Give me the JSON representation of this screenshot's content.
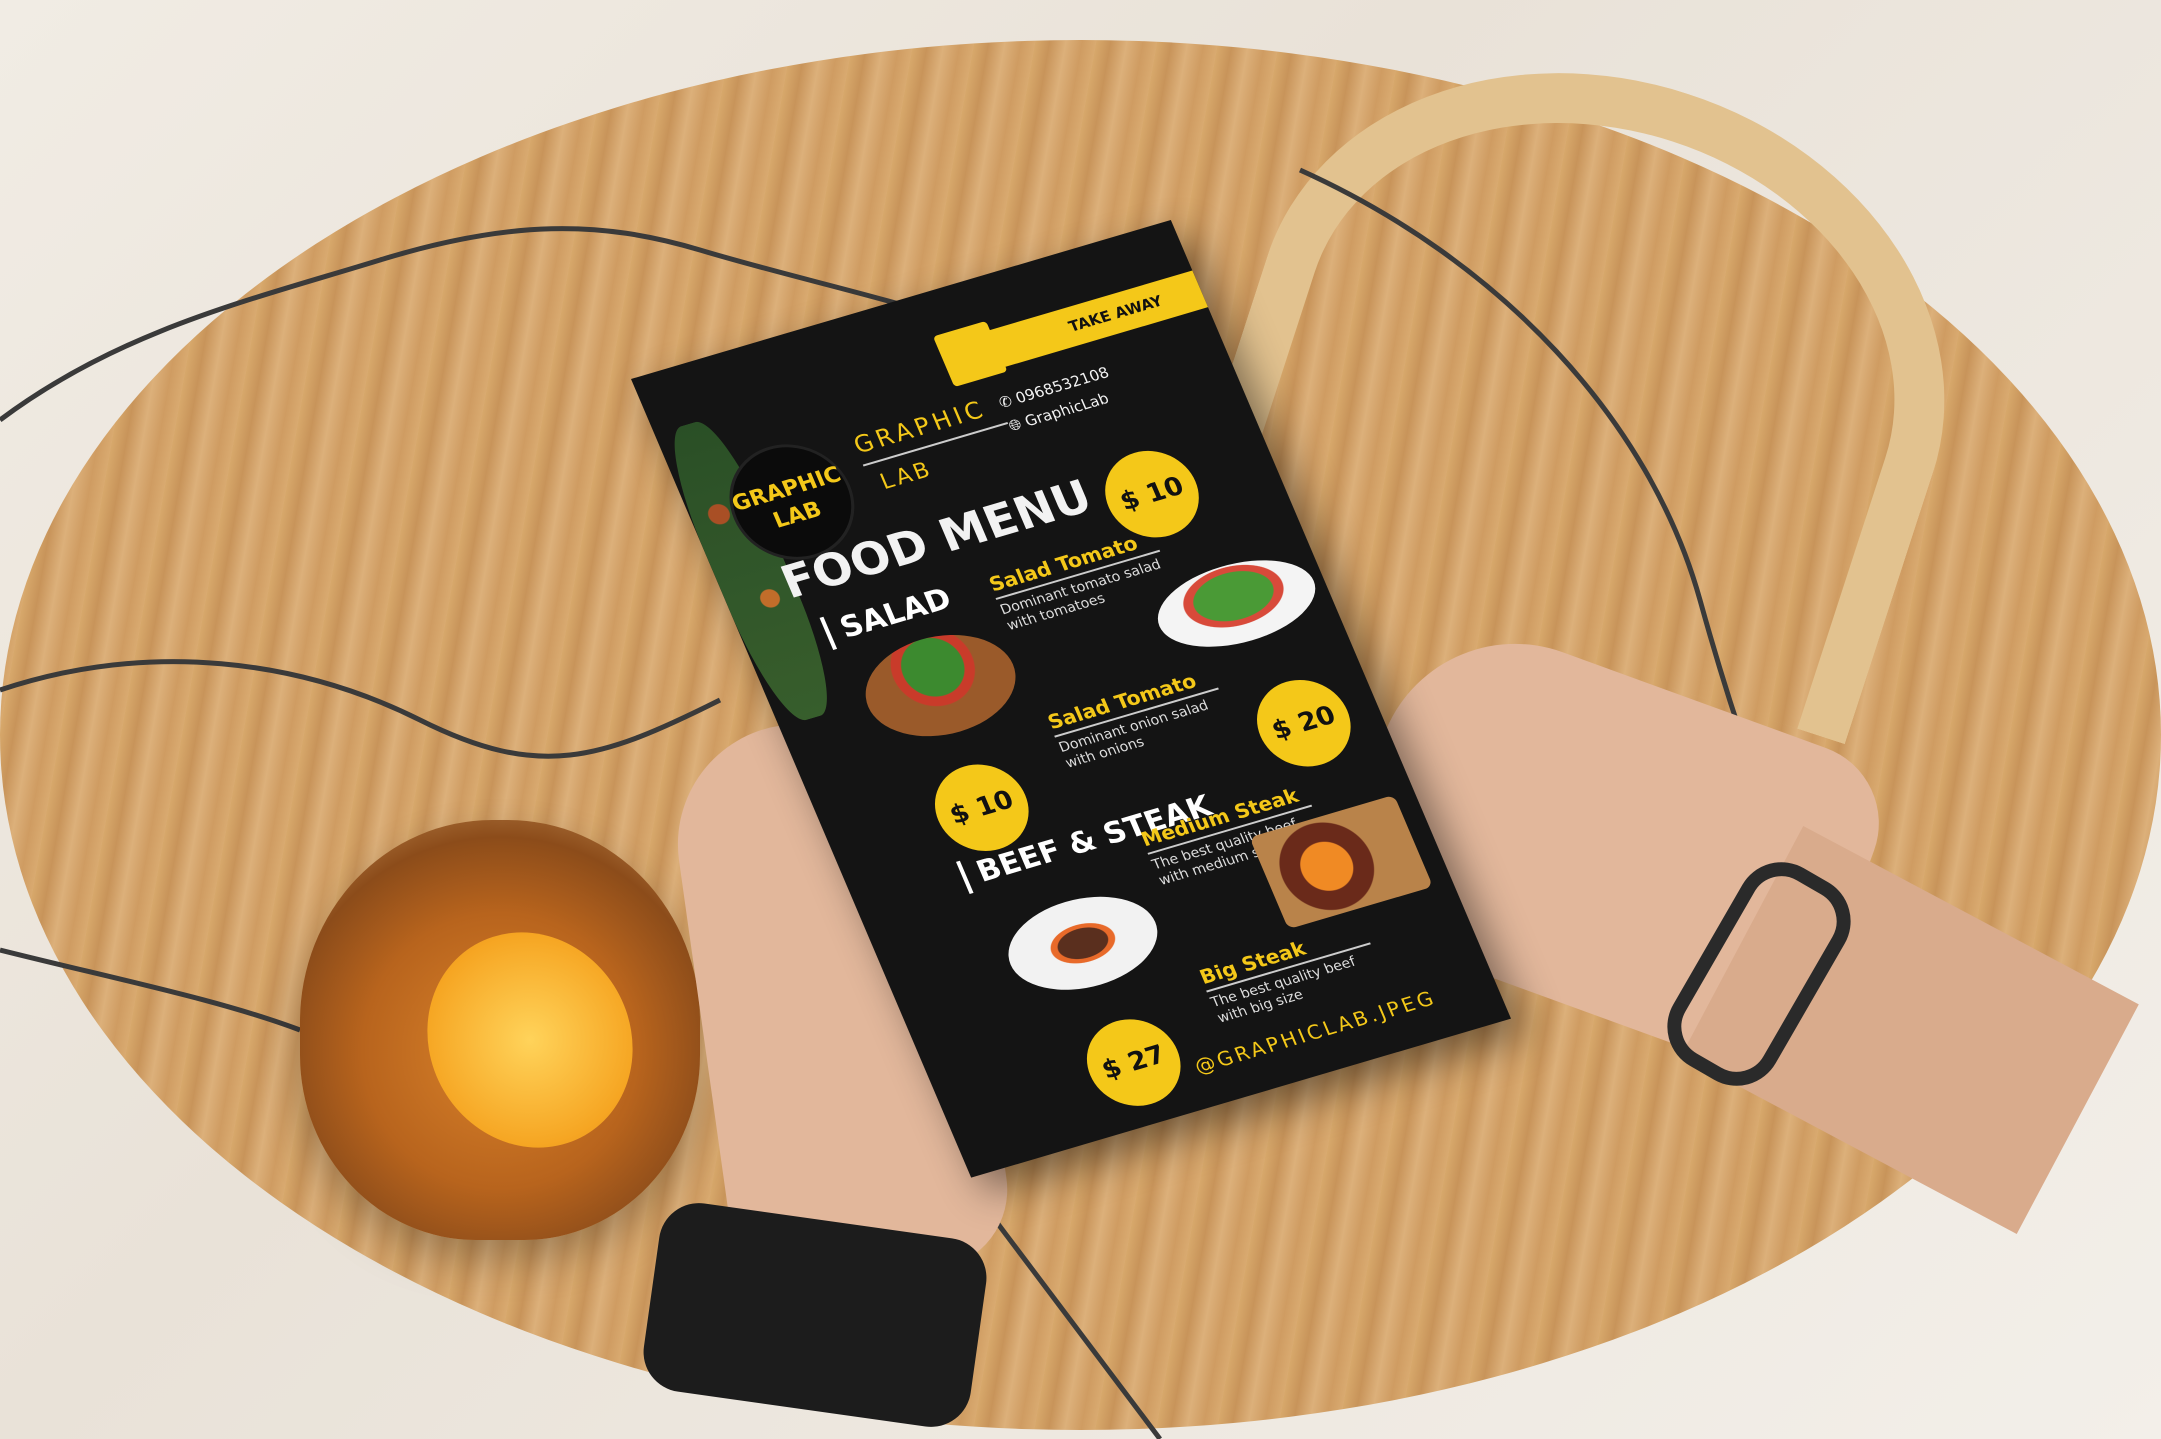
{
  "menu": {
    "logo_text": [
      "GRAPHIC",
      "LAB"
    ],
    "brand_line1": "GRAPHIC",
    "brand_line2": "LAB",
    "take_away": "TAKE AWAY",
    "phone": "0968532108",
    "website": "GraphicLab",
    "title": "FOOD MENU",
    "sections": [
      {
        "name": "SALAD",
        "items": [
          {
            "name": "Salad Tomato",
            "description": "Dominant tomato salad with tomatoes",
            "price": "$ 10"
          },
          {
            "name": "Salad Tomato",
            "description": "Dominant onion salad with onions",
            "price": "$ 10"
          }
        ]
      },
      {
        "name": "BEEF & STEAK",
        "items": [
          {
            "name": "Medium Steak",
            "description": "The best quality beef with medium size",
            "price": "$ 20"
          },
          {
            "name": "Big Steak",
            "description": "The best quality beef with big size",
            "price": "$ 27"
          }
        ]
      }
    ],
    "footer": "@GRAPHICLAB.JPEG",
    "colors": {
      "accent": "#f4c819",
      "background": "#141414"
    }
  }
}
